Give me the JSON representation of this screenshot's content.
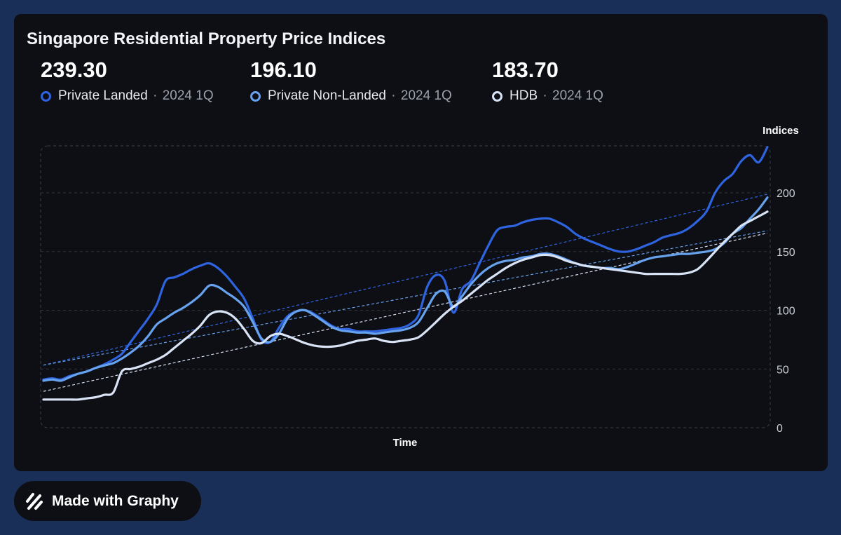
{
  "chart_data": {
    "type": "line",
    "title": "Singapore Residential Property Price Indices",
    "xlabel": "Time",
    "ylabel": "Indices",
    "ylim": [
      0,
      240
    ],
    "yticks": [
      0,
      50,
      100,
      150,
      200
    ],
    "grid": true,
    "legend": "top",
    "trendlines": true,
    "series": [
      {
        "name": "Private Landed",
        "color": "#2f64e0",
        "latest": "239.30",
        "period": "2024 1Q",
        "values": [
          41,
          42,
          41,
          44,
          46,
          48,
          51,
          54,
          58,
          63,
          73,
          83,
          93,
          105,
          125,
          128,
          131,
          135,
          138,
          140,
          136,
          129,
          120,
          110,
          93,
          75,
          73,
          85,
          95,
          99,
          100,
          97,
          92,
          87,
          84,
          84,
          82,
          82,
          82,
          83,
          84,
          85,
          88,
          96,
          120,
          130,
          125,
          98,
          118,
          125,
          140,
          155,
          168,
          171,
          172,
          175,
          177,
          178,
          178,
          175,
          171,
          165,
          161,
          158,
          155,
          152,
          150,
          150,
          152,
          155,
          158,
          162,
          164,
          166,
          170,
          176,
          184,
          200,
          210,
          216,
          227,
          232,
          226,
          239
        ]
      },
      {
        "name": "Private Non-Landed",
        "color": "#67a2ef",
        "latest": "196.10",
        "period": "2024 1Q",
        "values": [
          40,
          41,
          40,
          43,
          46,
          48,
          51,
          53,
          55,
          59,
          64,
          70,
          78,
          88,
          93,
          98,
          102,
          107,
          113,
          121,
          120,
          115,
          110,
          103,
          90,
          76,
          73,
          80,
          93,
          99,
          100,
          96,
          91,
          86,
          83,
          82,
          81,
          81,
          80,
          81,
          82,
          83,
          85,
          90,
          102,
          114,
          116,
          103,
          112,
          122,
          130,
          136,
          140,
          142,
          143,
          145,
          146,
          148,
          148,
          146,
          143,
          140,
          138,
          137,
          136,
          136,
          135,
          137,
          140,
          143,
          145,
          146,
          147,
          148,
          148,
          149,
          150,
          152,
          157,
          165,
          170,
          178,
          186,
          196
        ]
      },
      {
        "name": "HDB",
        "color": "#d9e3f6",
        "latest": "183.70",
        "period": "2024 1Q",
        "values": [
          24,
          24,
          24,
          24,
          24,
          25,
          26,
          28,
          30,
          48,
          50,
          52,
          55,
          58,
          62,
          68,
          74,
          80,
          87,
          96,
          99,
          98,
          93,
          84,
          74,
          72,
          78,
          80,
          78,
          75,
          72,
          70,
          69,
          69,
          70,
          72,
          74,
          75,
          76,
          74,
          73,
          74,
          75,
          77,
          83,
          90,
          97,
          103,
          108,
          114,
          120,
          126,
          131,
          136,
          140,
          143,
          145,
          147,
          147,
          145,
          142,
          140,
          138,
          137,
          136,
          135,
          134,
          133,
          132,
          131,
          131,
          131,
          131,
          131,
          132,
          135,
          142,
          150,
          158,
          165,
          172,
          176,
          180,
          184
        ]
      }
    ]
  },
  "branding": {
    "label": "Made with Graphy"
  }
}
